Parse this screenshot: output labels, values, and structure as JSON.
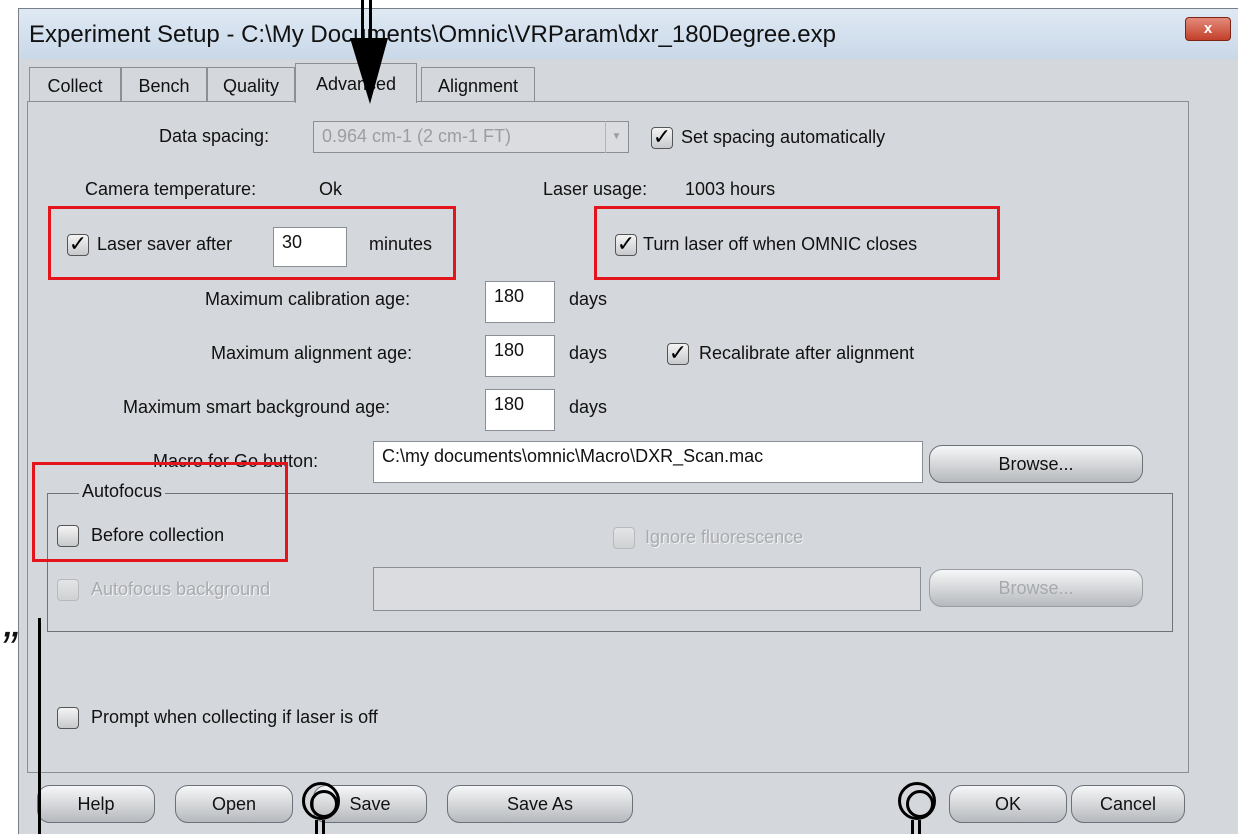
{
  "window": {
    "title": "Experiment Setup - C:\\My Documents\\Omnic\\VRParam\\dxr_180Degree.exp",
    "close_glyph": "x"
  },
  "tabs": [
    {
      "label": "Collect"
    },
    {
      "label": "Bench"
    },
    {
      "label": "Quality"
    },
    {
      "label": "Advanced",
      "active": true
    },
    {
      "label": "Alignment"
    }
  ],
  "advanced": {
    "data_spacing_label": "Data spacing:",
    "data_spacing_value": "0.964 cm-1 (2 cm-1 FT)",
    "set_spacing_auto_label": "Set spacing automatically",
    "set_spacing_auto_checked": true,
    "camera_temperature_label": "Camera temperature:",
    "camera_temperature_value": "Ok",
    "laser_usage_label": "Laser usage:",
    "laser_usage_value": "1003 hours",
    "laser_saver_label": "Laser saver after",
    "laser_saver_value": "30",
    "laser_saver_unit": "minutes",
    "laser_saver_checked": true,
    "turn_laser_off_label": "Turn laser off when OMNIC closes",
    "turn_laser_off_checked": true,
    "max_calibration_age_label": "Maximum calibration age:",
    "max_calibration_age_value": "180",
    "max_alignment_age_label": "Maximum alignment age:",
    "max_alignment_age_value": "180",
    "max_smart_background_age_label": "Maximum smart background age:",
    "max_smart_background_age_value": "180",
    "days_unit": "days",
    "recalibrate_label": "Recalibrate after alignment",
    "recalibrate_checked": true,
    "macro_label": "Macro for Go button:",
    "macro_value": "C:\\my documents\\omnic\\Macro\\DXR_Scan.mac",
    "browse_label": "Browse...",
    "autofocus": {
      "legend": "Autofocus",
      "before_collection_label": "Before collection",
      "before_collection_checked": false,
      "ignore_fluorescence_label": "Ignore fluorescence",
      "autofocus_background_label": "Autofocus background",
      "background_value": "",
      "browse_label": "Browse..."
    },
    "prompt_laser_off_label": "Prompt when collecting if laser is off",
    "prompt_laser_off_checked": false
  },
  "footer": {
    "help_label": "Help",
    "open_label": "Open",
    "save_label": "Save",
    "save_as_label": "Save As",
    "ok_label": "OK",
    "cancel_label": "Cancel"
  },
  "annotations": {
    "stray_quote": "”",
    "highlight_color": "#e3141c"
  }
}
